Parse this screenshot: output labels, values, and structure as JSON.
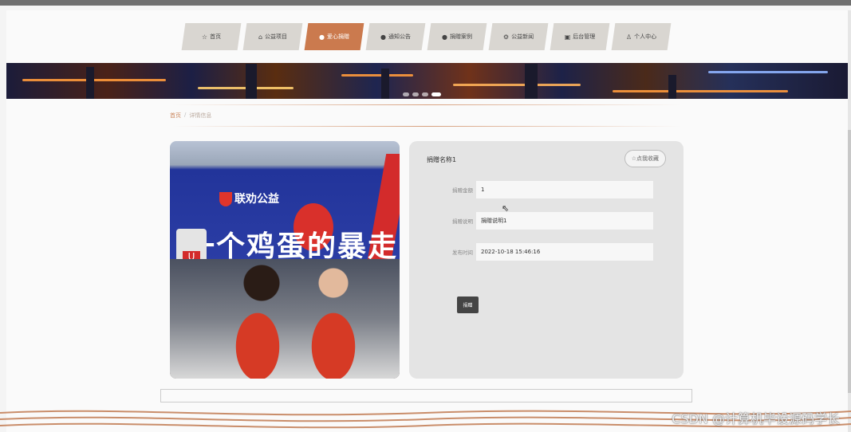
{
  "nav": {
    "items": [
      {
        "icon": "☆",
        "label": "首页"
      },
      {
        "icon": "⌂",
        "label": "公益项目"
      },
      {
        "icon": "●",
        "label": "爱心捐赠"
      },
      {
        "icon": "●",
        "label": "通知公告"
      },
      {
        "icon": "●",
        "label": "捐赠案例"
      },
      {
        "icon": "⚙",
        "label": "公益新闻"
      },
      {
        "icon": "▣",
        "label": "后台管理"
      },
      {
        "icon": "♙",
        "label": "个人中心"
      }
    ],
    "active_index": 2
  },
  "breadcrumb": {
    "home": "首页",
    "sep": "/",
    "current": "详情信息"
  },
  "photo": {
    "logo_text": "联劝公益",
    "slogan": "一个鸡蛋的暴走"
  },
  "detail": {
    "title": "捐赠名称1",
    "favorite_label": "☆点我收藏",
    "fields": [
      {
        "label": "捐赠金额",
        "value": "1"
      },
      {
        "label": "捐赠说明",
        "value": "捐赠说明1"
      },
      {
        "label": "发布时间",
        "value": "2022-10-18 15:46:16"
      }
    ],
    "donate_label": "捐赠"
  },
  "watermark": "CSDN @计算机毕设源码学长",
  "colors": {
    "accent": "#cb7a4e",
    "nav_bg": "#d9d6d1"
  }
}
